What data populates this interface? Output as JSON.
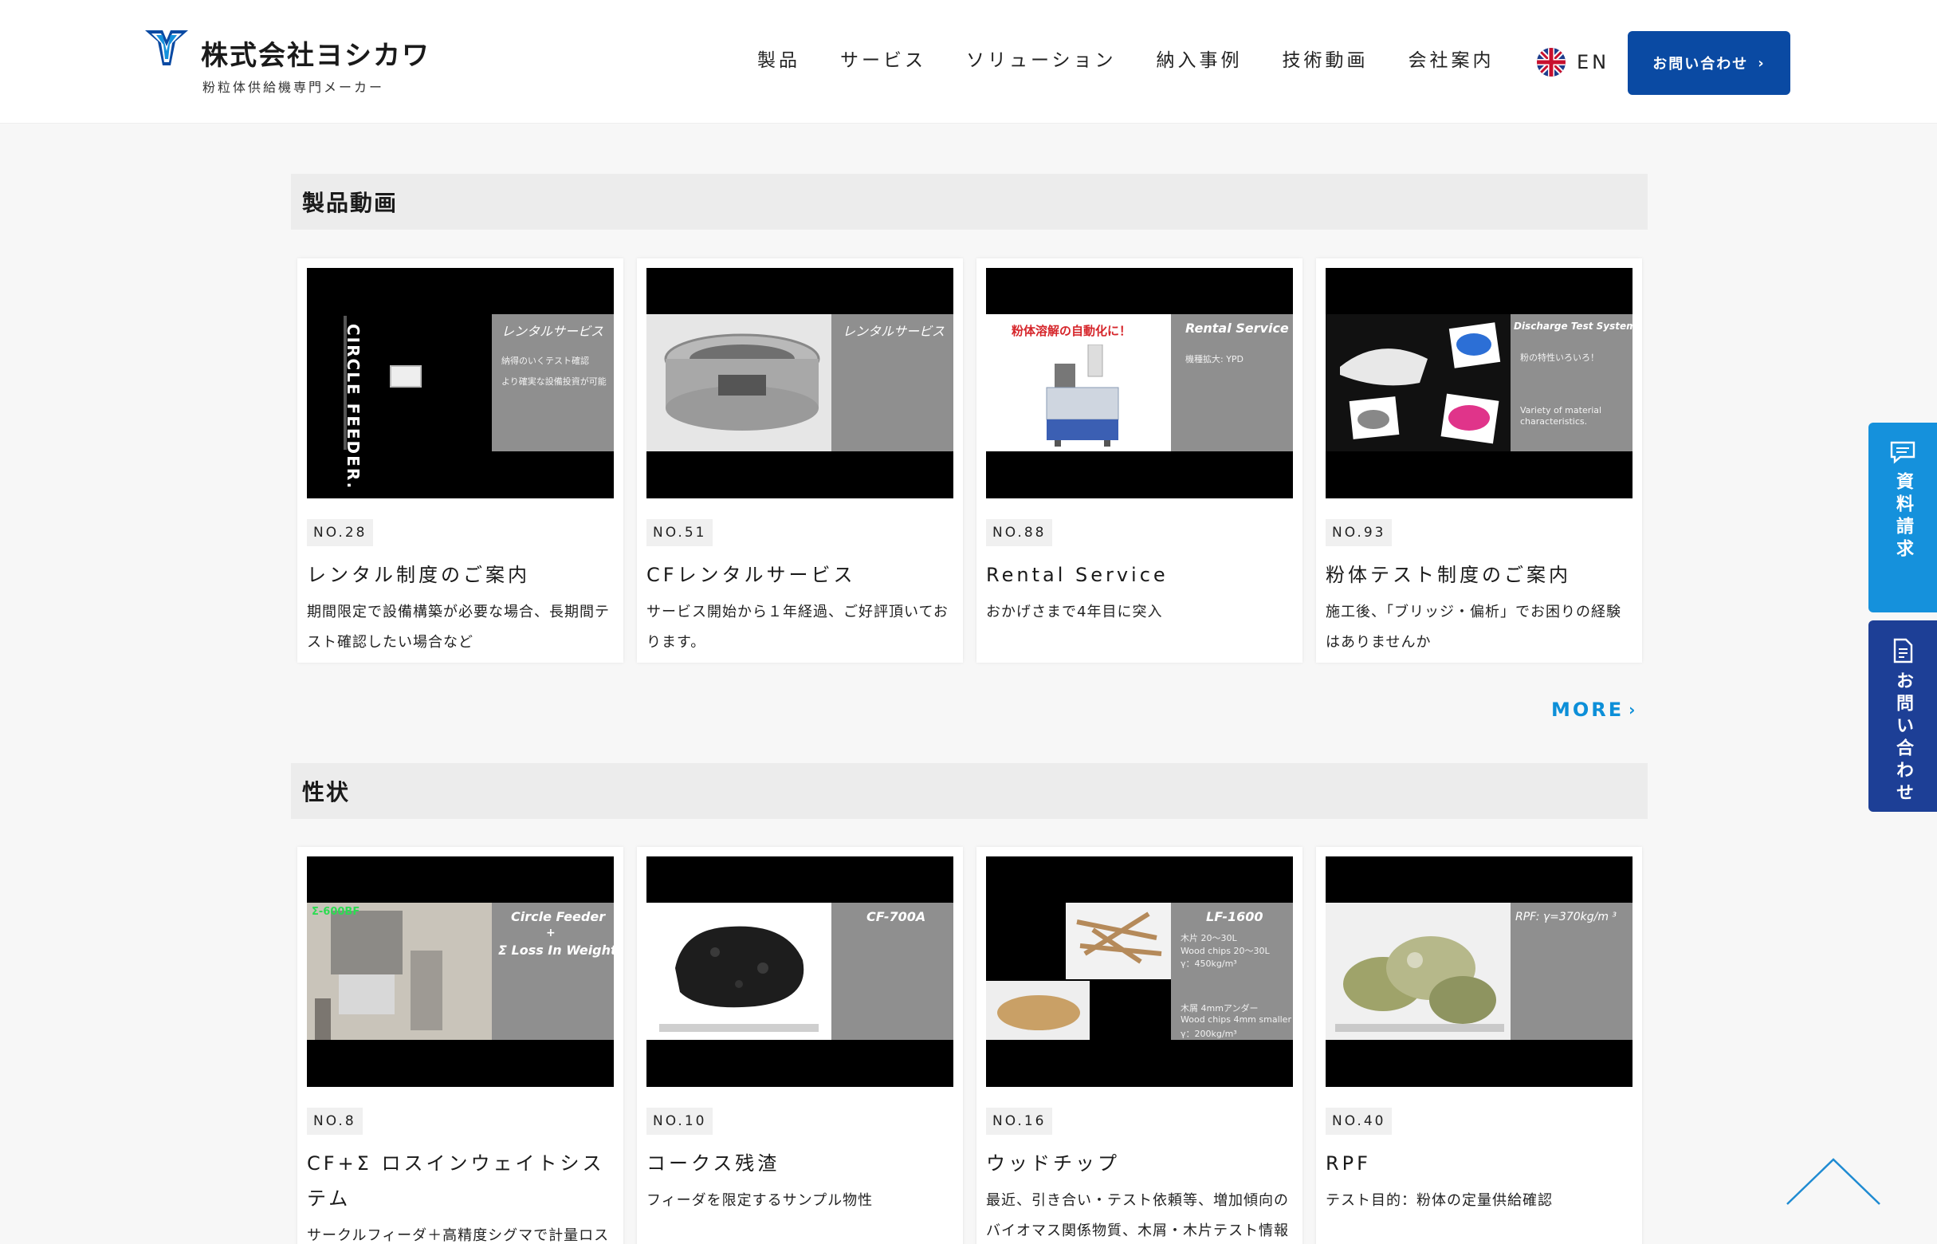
{
  "header": {
    "company_name": "株式会社ヨシカワ",
    "tagline": "粉粒体供給機専門メーカー",
    "nav": [
      "製品",
      "サービス",
      "ソリューション",
      "納入事例",
      "技術動画",
      "会社案内"
    ],
    "lang_label": "EN",
    "contact_label": "お問い合わせ",
    "brand_color": "#0a4aa3"
  },
  "sections": [
    {
      "heading": "製品動画",
      "cards": [
        {
          "no": "NO.28",
          "title": "レンタル制度のご案内",
          "desc": "期間限定で設備構築が必要な場合、長期間テスト確認したい場合など",
          "thumb": {
            "vertical_text": "CIRCLE FEEDER.",
            "panel_title": "レンタルサービス",
            "panel_line1": "納得のいくテスト確認",
            "panel_line2": "より確実な設備投資が可能"
          }
        },
        {
          "no": "NO.51",
          "title": "CFレンタルサービス",
          "desc": "サービス開始から１年経過、ご好評頂いております。",
          "thumb": {
            "panel_title": "レンタルサービス"
          }
        },
        {
          "no": "NO.88",
          "title": "Rental Service",
          "desc": "おかげさまで4年目に突入",
          "thumb": {
            "left_caption": "粉体溶解の自動化に！",
            "panel_title": "Rental Service",
            "panel_line1": "機種拡大: YPD"
          }
        },
        {
          "no": "NO.93",
          "title": "粉体テスト制度のご案内",
          "desc": "施工後、「ブリッジ・偏析」でお困りの経験はありませんか",
          "thumb": {
            "panel_title": "Discharge Test System",
            "panel_line1": "粉の特性いろいろ！",
            "panel_line2": "Variety of material",
            "panel_line3": "characteristics."
          }
        }
      ],
      "more_label": "MORE"
    },
    {
      "heading": "性状",
      "cards": [
        {
          "no": "NO.8",
          "title": "CF+Σ ロスインウェイトシステム",
          "desc": "サークルフィーダ＋高精度シグマで計量ロス",
          "thumb": {
            "corner_label": "Σ-600BF",
            "panel_line1": "Circle Feeder",
            "panel_line2": "+",
            "panel_line3": "Σ Loss In Weight"
          }
        },
        {
          "no": "NO.10",
          "title": "コークス残渣",
          "desc": "フィーダを限定するサンプル物性",
          "thumb": {
            "panel_title": "CF-700A"
          }
        },
        {
          "no": "NO.16",
          "title": "ウッドチップ",
          "desc": "最近、引き合い・テスト依頼等、増加傾向のバイオマス関係物質、木屑・木片テスト情報",
          "thumb": {
            "panel_title": "LF-1600",
            "panel_line1": "木片 20〜30L",
            "panel_line2": "Wood chips 20〜30L",
            "panel_line3": "γ：450kg/m³",
            "panel_line4": "木屑 4mmアンダー",
            "panel_line5": "Wood chips 4mm smaller",
            "panel_line6": "γ：200kg/m³"
          }
        },
        {
          "no": "NO.40",
          "title": "RPF",
          "desc": "テスト目的：粉体の定量供給確認",
          "thumb": {
            "panel_title": "RPF: γ=370kg/m ³"
          }
        }
      ]
    }
  ],
  "side_tabs": {
    "doc_request": "資料請求",
    "inquiry": "お問い合わせ",
    "doc_color": "#1591dc",
    "inquiry_color": "#1d3f96"
  },
  "accent_color": "#0d8fd8"
}
